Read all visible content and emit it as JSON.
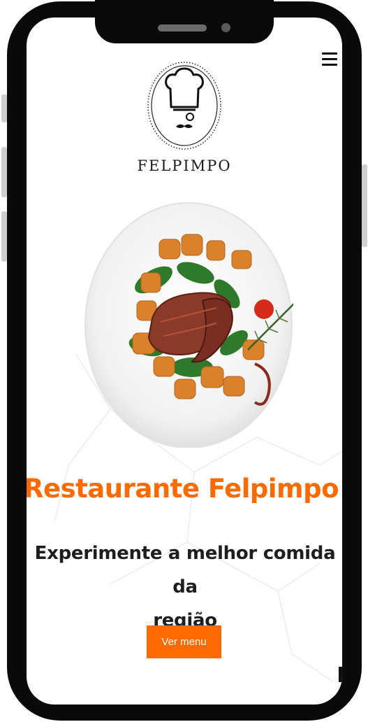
{
  "header": {
    "brand_name": "FELPIMPO",
    "menu_icon": "hamburger-menu-icon",
    "logo_icon": "chef-hat-logo-icon"
  },
  "hero": {
    "image": "steak-with-potatoes-plate",
    "title": "Restaurante Felpimpo",
    "subtitle_line1": "Experimente a melhor comida da",
    "subtitle_line2": "região",
    "cta_label": "Ver menu"
  },
  "colors": {
    "accent": "#ff6a00",
    "text_dark": "#1e1e1e",
    "frame": "#0a0a0a"
  }
}
